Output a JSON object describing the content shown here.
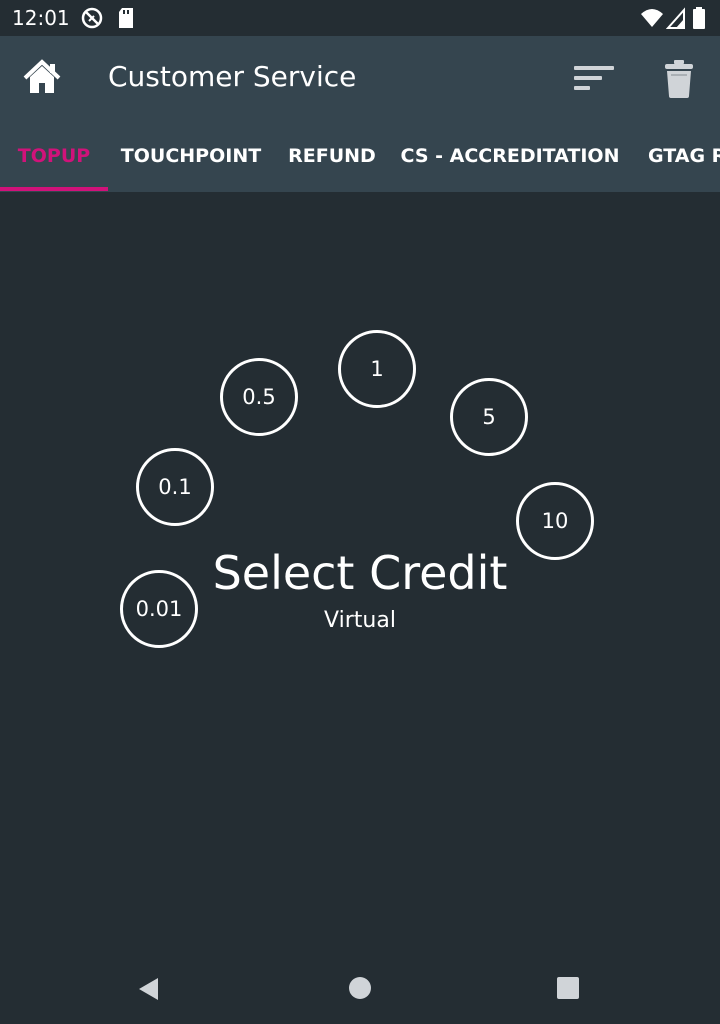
{
  "status_bar": {
    "time": "12:01",
    "icons": [
      "sync-disabled-icon",
      "sd-card-icon",
      "wifi-icon",
      "signal-icon",
      "battery-icon"
    ]
  },
  "app_bar": {
    "title": "Customer Service",
    "icons": [
      "home-icon",
      "sort-icon",
      "trash-icon"
    ]
  },
  "tabs": [
    {
      "label": "TOPUP",
      "active": true
    },
    {
      "label": "TOUCHPOINT",
      "active": false
    },
    {
      "label": "REFUND",
      "active": false
    },
    {
      "label": "CS - ACCREDITATION",
      "active": false
    },
    {
      "label": "GTAG R",
      "active": false
    }
  ],
  "credits": [
    "0.01",
    "0.1",
    "0.5",
    "1",
    "5",
    "10"
  ],
  "main": {
    "title": "Select Credit",
    "subtitle": "Virtual"
  },
  "colors": {
    "background": "#242d33",
    "app_bar": "#35454f",
    "accent": "#d1127a"
  },
  "nav_bar": {
    "icons": [
      "back-icon",
      "home-circle-icon",
      "recents-icon"
    ]
  }
}
